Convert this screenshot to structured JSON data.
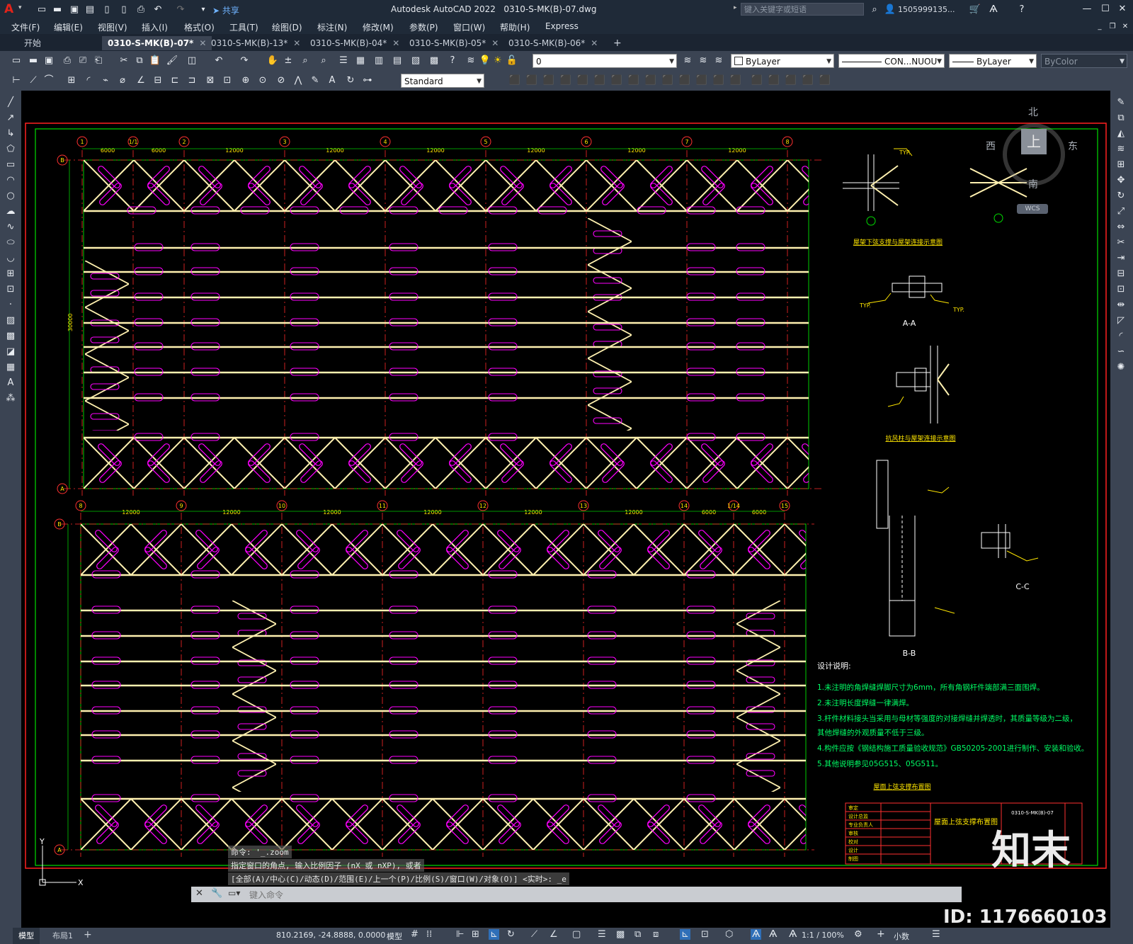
{
  "app": {
    "title": "Autodesk AutoCAD 2022",
    "filename": "0310-S-MK(B)-07.dwg",
    "search_placeholder": "键入关键字或短语",
    "user": "1505999135...",
    "share_label": "共享",
    "logo": "A"
  },
  "menu": [
    "文件(F)",
    "编辑(E)",
    "视图(V)",
    "插入(I)",
    "格式(O)",
    "工具(T)",
    "绘图(D)",
    "标注(N)",
    "修改(M)",
    "参数(P)",
    "窗口(W)",
    "帮助(H)",
    "Express"
  ],
  "tabs": [
    {
      "label": "开始",
      "active": false
    },
    {
      "label": "0310-S-MK(B)-07*",
      "active": true
    },
    {
      "label": "0310-S-MK(B)-13*",
      "active": false
    },
    {
      "label": "0310-S-MK(B)-04*",
      "active": false
    },
    {
      "label": "0310-S-MK(B)-05*",
      "active": false
    },
    {
      "label": "0310-S-MK(B)-06*",
      "active": false
    }
  ],
  "toolbar": {
    "layer_value": "0",
    "color_value": "ByLayer",
    "linetype_value": "CON...NUOU",
    "lineweight_value": "ByLayer",
    "plotstyle_value": "ByColor",
    "textstyle_value": "Standard"
  },
  "viewcube": {
    "north": "北",
    "south": "南",
    "east": "东",
    "west": "西",
    "top": "上",
    "wcs": "WCS"
  },
  "drawing": {
    "top_grid_labels": [
      "1",
      "1/1",
      "2",
      "3",
      "4",
      "5",
      "6",
      "7",
      "8"
    ],
    "top_dims": [
      "6000",
      "6000",
      "12000",
      "12000",
      "12000",
      "12000",
      "12000",
      "12000"
    ],
    "bottom_grid_labels": [
      "8",
      "9",
      "10",
      "11",
      "12",
      "13",
      "14",
      "1/14",
      "15"
    ],
    "bottom_dims": [
      "12000",
      "12000",
      "12000",
      "12000",
      "12000",
      "12000",
      "6000",
      "6000"
    ],
    "axis_B": "B",
    "axis_A": "A",
    "left_total_dim": "30000",
    "detail_title_1": "屋架下弦支撑与屋架连接示意图",
    "detail_title_2": "抗风柱与屋架连接示意图",
    "section_AA": "A-A",
    "section_BB": "B-B",
    "section_CC": "C-C",
    "typ": "TYP.",
    "notes_title": "设计说明:",
    "notes": [
      "1.未注明的角焊缝焊脚尺寸为6mm，所有角钢杆件端部满三面围焊。",
      "2.未注明长度焊缝一律满焊。",
      "3.杆件材料接头当采用与母材等强度的对接焊缝并焊透时，其质量等级为二级，",
      "   其他焊缝的外观质量不低于三级。",
      "4.构件应按《钢结构施工质量验收规范》GB50205-2001进行制作、安装和验收。",
      "5.其他说明参见05G515、05G511。"
    ],
    "plan_title": "屋面上弦支撑布置图",
    "titleblock_name": "屋面上弦支撑布置图",
    "titleblock_no": "0310-S-MK(B)-07",
    "tb_rows": [
      "审定",
      "设计总监",
      "专业负责人",
      "审核",
      "校对",
      "设计",
      "制图"
    ]
  },
  "command": {
    "line1": "命令: '_.zoom",
    "line2": "指定窗口的角点, 输入比例因子 (nX 或 nXP), 或者",
    "line3": "[全部(A)/中心(C)/动态(D)/范围(E)/上一个(P)/比例(S)/窗口(W)/对象(O)] <实时>: _e",
    "placeholder": "键入命令"
  },
  "status": {
    "coords": "810.2169, -24.8888, 0.0000",
    "model": "模型",
    "scale": "1:1 / 100%",
    "units": "小数",
    "model_tab": "模型",
    "layout_tab": "布局1"
  },
  "watermark": {
    "logo": "知末",
    "id": "ID: 1176660103"
  }
}
